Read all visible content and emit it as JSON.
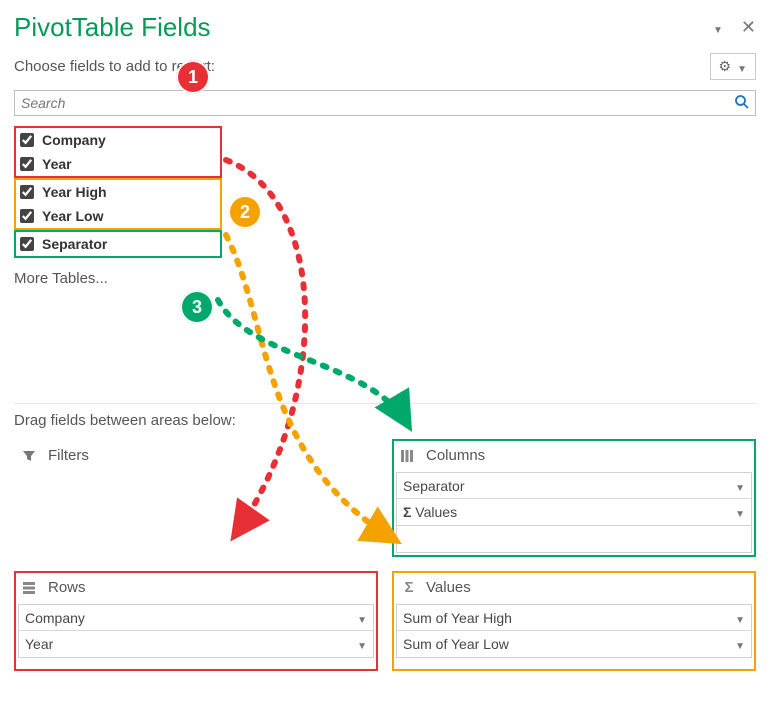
{
  "pane": {
    "title": "PivotTable Fields",
    "subtitle": "Choose fields to add to report:",
    "gear_tooltip": "Tools"
  },
  "search": {
    "placeholder": "Search"
  },
  "field_groups": [
    {
      "hl": "hl-group1",
      "fields": [
        {
          "label": "Company",
          "checked": true
        },
        {
          "label": "Year",
          "checked": true
        }
      ]
    },
    {
      "hl": "hl-group2",
      "fields": [
        {
          "label": "Year High",
          "checked": true
        },
        {
          "label": "Year Low",
          "checked": true
        }
      ]
    },
    {
      "hl": "hl-group3",
      "fields": [
        {
          "label": "Separator",
          "checked": true
        }
      ]
    }
  ],
  "more_tables": "More Tables...",
  "instruction": "Drag fields between areas below:",
  "areas": {
    "filters": {
      "label": "Filters",
      "items": []
    },
    "columns": {
      "label": "Columns",
      "items": [
        "Separator",
        "Σ Values"
      ],
      "hl": "hl-columns"
    },
    "rows": {
      "label": "Rows",
      "items": [
        "Company",
        "Year"
      ],
      "hl": "hl-rows"
    },
    "values": {
      "label": "Values",
      "items": [
        "Sum of Year High",
        "Sum of Year Low"
      ],
      "hl": "hl-values"
    }
  },
  "badges": {
    "b1": "1",
    "b2": "2",
    "b3": "3"
  },
  "colors": {
    "red": "#e63036",
    "amber": "#f5a200",
    "teal": "#00a86b"
  }
}
